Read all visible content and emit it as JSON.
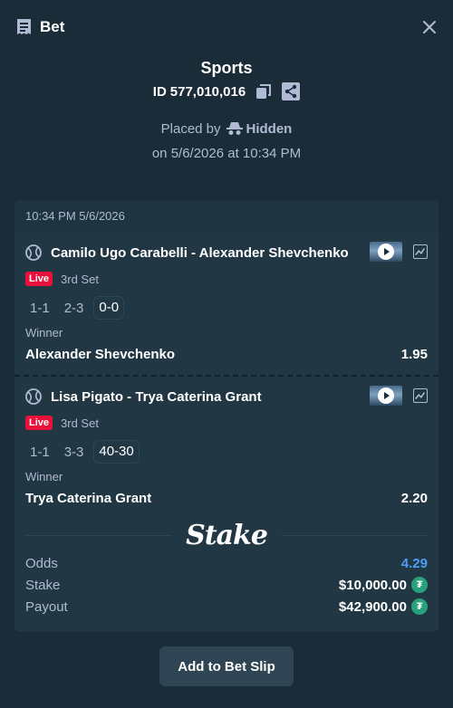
{
  "header": {
    "title": "Bet"
  },
  "bet_info": {
    "sport": "Sports",
    "id_prefix": "ID",
    "id_value": "577,010,016",
    "placed_by_label": "Placed by",
    "placed_by_user": "Hidden",
    "placed_on": "on 5/6/2026 at 10:34 PM"
  },
  "card": {
    "timestamp": "10:34 PM 5/6/2026",
    "bets": [
      {
        "match": "Camilo Ugo Carabelli - Alexander Shevchenko",
        "live_label": "Live",
        "set": "3rd Set",
        "scores": [
          "1-1",
          "2-3",
          "0-0"
        ],
        "market": "Winner",
        "selection": "Alexander Shevchenko",
        "odds": "1.95"
      },
      {
        "match": "Lisa Pigato - Trya Caterina Grant",
        "live_label": "Live",
        "set": "3rd Set",
        "scores": [
          "1-1",
          "3-3",
          "40-30"
        ],
        "market": "Winner",
        "selection": "Trya Caterina Grant",
        "odds": "2.20"
      }
    ],
    "logo": "Stake",
    "summary": {
      "odds_label": "Odds",
      "odds_value": "4.29",
      "stake_label": "Stake",
      "stake_value": "$10,000.00",
      "payout_label": "Payout",
      "payout_value": "$42,900.00",
      "currency_icon": "tether-icon",
      "currency_symbol": "₮"
    }
  },
  "actions": {
    "add_to_bet_slip": "Add to Bet Slip"
  },
  "colors": {
    "background": "#1a2c38",
    "card": "#213743",
    "muted_text": "#b1bad3",
    "live_red": "#e9113c",
    "odds_blue": "#4d9cf5",
    "tether_green": "#26a17b",
    "button": "#2f4553"
  }
}
